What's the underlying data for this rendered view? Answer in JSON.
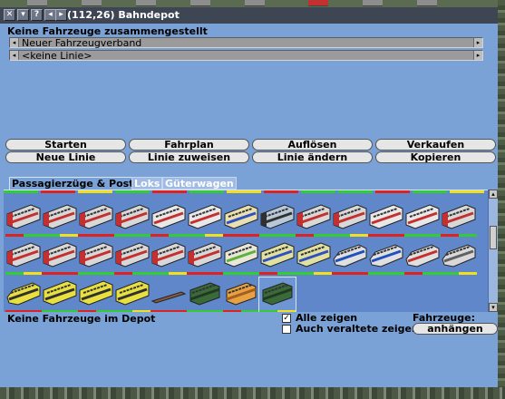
{
  "window": {
    "title": "(112,26) Bahndepot",
    "titlebar_buttons": [
      "close-icon",
      "minimize-icon",
      "help-icon",
      "prev-icon",
      "next-icon"
    ]
  },
  "header": {
    "no_convoy": "Keine Fahrzeuge zusammengestellt"
  },
  "convoy_selector": {
    "value": "Neuer Fahrzeugverband"
  },
  "line_selector": {
    "value": "<keine Linie>"
  },
  "actions": {
    "start": "Starten",
    "schedule": "Fahrplan",
    "dissolve": "Auflösen",
    "sell": "Verkaufen",
    "new_line": "Neue Linie",
    "assign_line": "Linie zuweisen",
    "edit_line": "Linie ändern",
    "copy": "Kopieren"
  },
  "tabs": [
    {
      "label": "Passagierzüge & Post",
      "active": true
    },
    {
      "label": "Loks",
      "active": false
    },
    {
      "label": "Güterwagen",
      "active": false
    }
  ],
  "vehicles": [
    {
      "kind": "train",
      "body": "#d8d8d8",
      "stripe": "#c43030",
      "cab": "red"
    },
    {
      "kind": "train",
      "body": "#d8d8d8",
      "stripe": "#c43030",
      "cab": "red"
    },
    {
      "kind": "train",
      "body": "#d8d8d8",
      "stripe": "#c43030",
      "cab": "red"
    },
    {
      "kind": "train",
      "body": "#d8d8d8",
      "stripe": "#c43030",
      "cab": "red"
    },
    {
      "kind": "train",
      "body": "#e8e8e8",
      "stripe": "#c43030",
      "cab": "white"
    },
    {
      "kind": "train",
      "body": "#e8e8e8",
      "stripe": "#c43030",
      "cab": "white"
    },
    {
      "kind": "train",
      "body": "#e8e0b0",
      "stripe": "#3050c0",
      "cab": "white"
    },
    {
      "kind": "train",
      "body": "#b8c8d8",
      "stripe": "#303030",
      "cab": "dark"
    },
    {
      "kind": "train",
      "body": "#d8d8d8",
      "stripe": "#c43030",
      "cab": "red"
    },
    {
      "kind": "train",
      "body": "#d8d8d8",
      "stripe": "#c43030",
      "cab": "red"
    },
    {
      "kind": "train",
      "body": "#e8e8e8",
      "stripe": "#c43030",
      "cab": "white"
    },
    {
      "kind": "train",
      "body": "#e8e8e8",
      "stripe": "#c43030",
      "cab": "white"
    },
    {
      "kind": "train",
      "body": "#d8d8d8",
      "stripe": "#c43030",
      "cab": "red"
    },
    {
      "kind": "train",
      "body": "#d8d8d8",
      "stripe": "#c43030",
      "cab": "red"
    },
    {
      "kind": "train",
      "body": "#d8d8d8",
      "stripe": "#c43030",
      "cab": "red"
    },
    {
      "kind": "train",
      "body": "#d8d8d8",
      "stripe": "#c43030",
      "cab": "red"
    },
    {
      "kind": "train",
      "body": "#d8d8d8",
      "stripe": "#c43030",
      "cab": "red"
    },
    {
      "kind": "train",
      "body": "#d8d8d8",
      "stripe": "#c43030",
      "cab": "red"
    },
    {
      "kind": "train",
      "body": "#d8d8d8",
      "stripe": "#c43030",
      "cab": "red"
    },
    {
      "kind": "train",
      "body": "#e8e8d8",
      "stripe": "#60b040",
      "cab": "white"
    },
    {
      "kind": "train",
      "body": "#e0e0a0",
      "stripe": "#3050c0",
      "cab": "white"
    },
    {
      "kind": "train",
      "body": "#e0e0a0",
      "stripe": "#3050c0",
      "cab": "white"
    },
    {
      "kind": "bullet",
      "body": "#e0e0e0",
      "stripe": "#2050c0",
      "cab": "white"
    },
    {
      "kind": "bullet",
      "body": "#e0e0e0",
      "stripe": "#2050c0",
      "cab": "white"
    },
    {
      "kind": "bullet",
      "body": "#e0e0e0",
      "stripe": "#c43030",
      "cab": "white"
    },
    {
      "kind": "bullet",
      "body": "#d8d8d8",
      "stripe": "#606060",
      "cab": "white"
    },
    {
      "kind": "bullet",
      "body": "#e8e040",
      "stripe": "#303030",
      "cab": "yellow"
    },
    {
      "kind": "train",
      "body": "#e8e040",
      "stripe": "#303030",
      "cab": "yellow"
    },
    {
      "kind": "train",
      "body": "#e8e040",
      "stripe": "#303030",
      "cab": "yellow"
    },
    {
      "kind": "train",
      "body": "#e8e040",
      "stripe": "#303030",
      "cab": "yellow"
    },
    {
      "kind": "flat",
      "body": "#8a5a3a",
      "stripe": "#5a3a20",
      "cab": "none"
    },
    {
      "kind": "box",
      "body": "#3a6a3a",
      "stripe": "#203a20",
      "cab": "none"
    },
    {
      "kind": "box",
      "body": "#e8a040",
      "stripe": "#a06020",
      "cab": "none"
    },
    {
      "kind": "coach",
      "body": "#3a6a3a",
      "stripe": "#203a20",
      "cab": "none"
    }
  ],
  "status": {
    "depot_empty": "Keine Fahrzeuge im Depot",
    "show_all": "Alle zeigen",
    "show_all_checked": true,
    "show_obsolete": "Auch veraltete zeigen",
    "show_obsolete_checked": false,
    "vehicles_label": "Fahrzeuge:",
    "attach_button": "anhängen"
  },
  "colors": {
    "window_bg": "#7aa2d6",
    "panel_bg": "#5f87ca",
    "bar_green": "#33cc33",
    "bar_red": "#dd2222",
    "bar_yellow": "#f0e020"
  }
}
